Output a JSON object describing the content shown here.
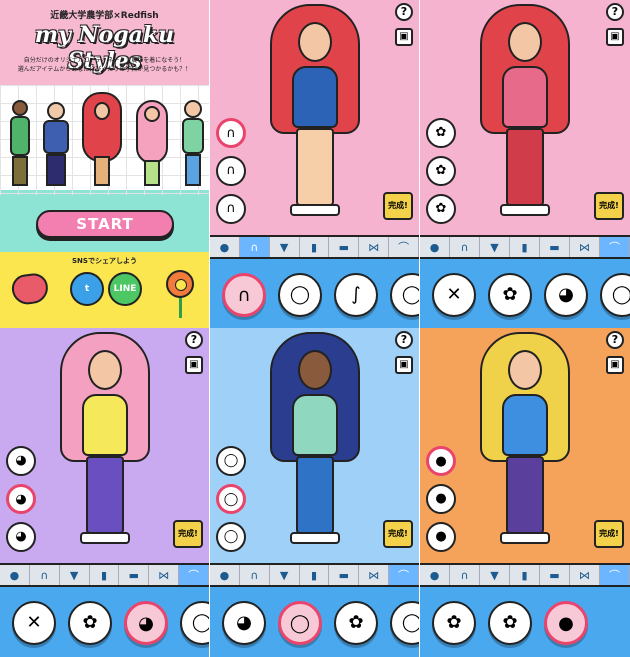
{
  "start": {
    "top_line": "近畿大学農学部×Redfish",
    "logo": "my Nogaku Styles",
    "subtitle_1": "自分だけのオリジナルコーディネートで農学を着になそう！",
    "subtitle_2": "選んだアイテムからあなたにぴったりの学科が見つかるかも？！",
    "start_button": "START",
    "share_label": "SNSでシェアしよう",
    "twitter": "t",
    "line": "LINE"
  },
  "editor": {
    "help": "?",
    "photo": "▣",
    "done": "完成!",
    "tabs": [
      "●",
      "∩",
      "▼",
      "▮",
      "▬",
      "⋈",
      "⌒"
    ],
    "panels": [
      {
        "bg": "#f6b3cf",
        "tab_active": 1,
        "side": [
          "∩",
          "∩",
          "∩"
        ],
        "side_sel": 0,
        "tray": [
          "∩",
          "◯",
          "∫",
          "◯"
        ],
        "tray_sel": 0
      },
      {
        "bg": "#f6b3cf",
        "tab_active": 6,
        "side": [
          "✿",
          "✿",
          "✿"
        ],
        "side_sel": -1,
        "tray": [
          "✕",
          "✿",
          "◕",
          "◯"
        ],
        "tray_sel": -1
      },
      {
        "bg": "#c9a9f0",
        "tab_active": 6,
        "side": [
          "◕",
          "◕",
          "◕"
        ],
        "side_sel": 1,
        "tray": [
          "✕",
          "✿",
          "◕",
          "◯"
        ],
        "tray_sel": 2
      },
      {
        "bg": "#9fd0f8",
        "tab_active": 6,
        "side": [
          "◯",
          "◯",
          "◯"
        ],
        "side_sel": 1,
        "tray": [
          "◕",
          "◯",
          "✿",
          "◯"
        ],
        "tray_sel": 1
      },
      {
        "bg": "#f5a25a",
        "tab_active": 6,
        "side": [
          "●",
          "●",
          "●"
        ],
        "side_sel": 0,
        "tray": [
          "✿",
          "✿",
          "●"
        ],
        "tray_sel": 2
      }
    ]
  }
}
